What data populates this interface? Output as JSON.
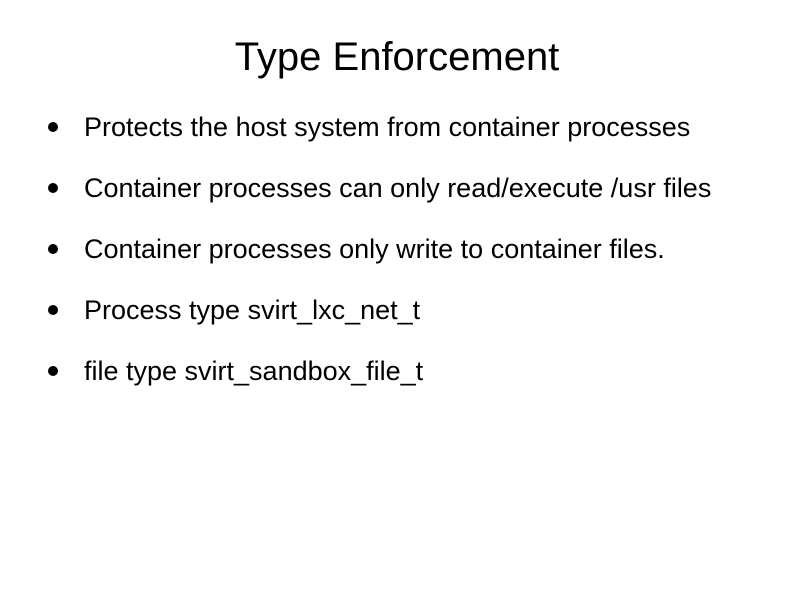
{
  "title": "Type Enforcement",
  "bullets": [
    "Protects the host system from container processes",
    "Container processes can only read/execute /usr files",
    "Container processes only write to container files.",
    "Process type svirt_lxc_net_t",
    "file type svirt_sandbox_file_t"
  ]
}
